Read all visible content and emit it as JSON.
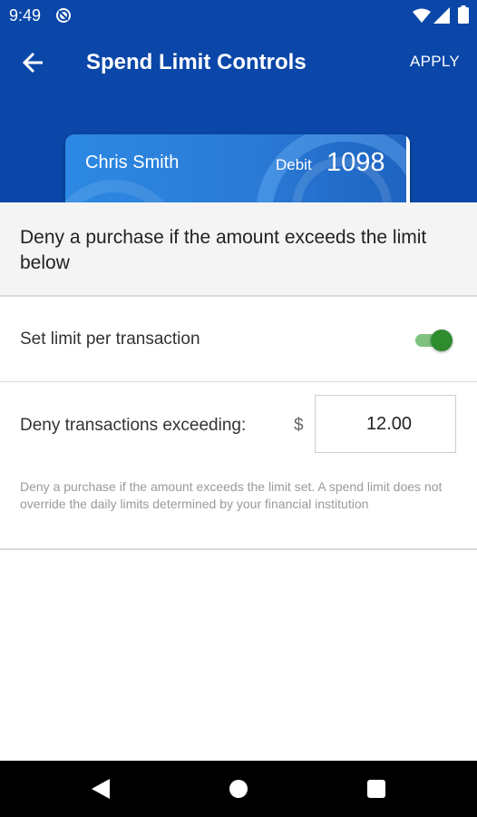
{
  "status_bar": {
    "time": "9:49"
  },
  "header": {
    "title": "Spend Limit Controls",
    "apply_label": "APPLY"
  },
  "card": {
    "holder": "Chris Smith",
    "type": "Debit",
    "last_digits": "1098"
  },
  "description": "Deny a purchase if the amount exceeds the limit below",
  "limit_toggle": {
    "label": "Set limit per transaction",
    "enabled": true
  },
  "limit_amount": {
    "label": "Deny transactions exceeding:",
    "currency_symbol": "$",
    "value": "12.00"
  },
  "note": "Deny a purchase if the amount exceeds the limit set. A spend limit does not override the daily limits determined by your financial institution",
  "colors": {
    "header_bg": "#0a47a8",
    "toggle_on": "#2e8b2e",
    "navbar_bg": "#000000"
  }
}
